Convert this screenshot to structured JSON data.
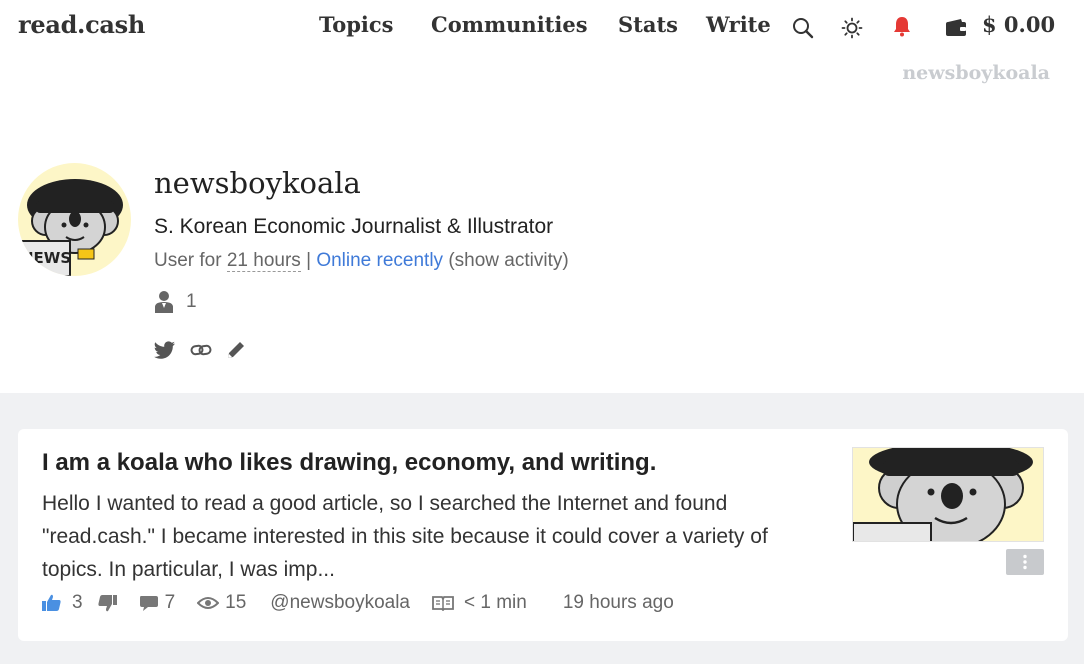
{
  "header": {
    "logo": "read.cash",
    "nav": {
      "topics": "Topics",
      "communities": "Communities",
      "stats": "Stats",
      "write": "Write"
    },
    "balance": "$ 0.00",
    "username": "newsboykoala",
    "icons": [
      "search-icon",
      "sun-icon",
      "bell-icon",
      "wallet-icon"
    ],
    "accent": "#e53935"
  },
  "profile": {
    "name": "newsboykoala",
    "bio": "S. Korean Economic Journalist & Illustrator",
    "user_for_prefix": "User for ",
    "user_for_value": "21 hours",
    "separator": " | ",
    "online": "Online recently",
    "show_activity": " (show activity)",
    "followers": "1",
    "avatar_text": "NEWS",
    "link_color": "#3f7ad8"
  },
  "article": {
    "title": "I am a koala who likes drawing, economy, and writing.",
    "excerpt": "Hello I wanted to read a good article, so I searched the Internet and found \"read.cash.\" I became interested in this site because it could cover a variety of topics. In particular, I was imp...",
    "upvotes": "3",
    "comments": "7",
    "views": "15",
    "author": "@newsboykoala",
    "read_time": "< 1 min",
    "posted": "19 hours ago",
    "upvote_color": "#4a90e2"
  }
}
